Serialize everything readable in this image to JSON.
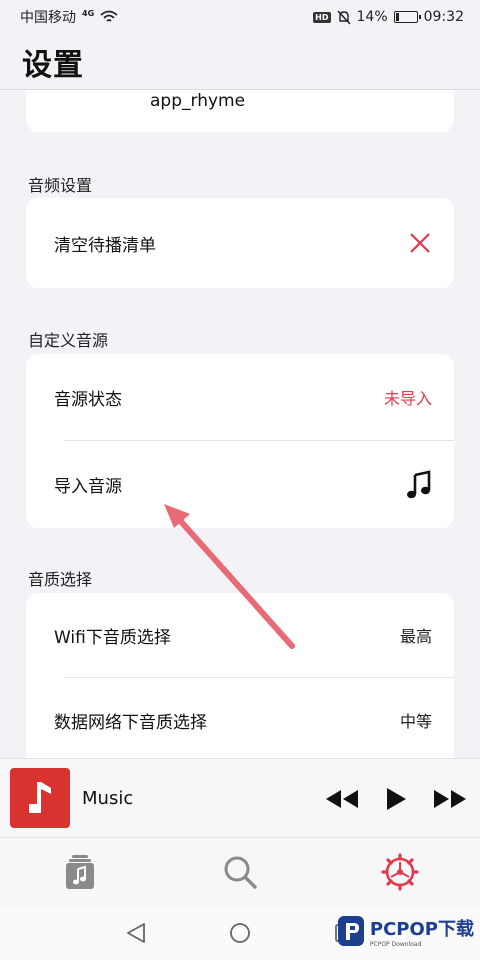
{
  "status_bar": {
    "carrier": "中国移动",
    "network": "4G",
    "hd": "HD",
    "battery_percent": "14%",
    "battery_level": 0.14,
    "time": "09:32"
  },
  "header": {
    "title": "设置"
  },
  "partial_card": {
    "value": "app_rhyme"
  },
  "sections": {
    "audio": {
      "label": "音频设置",
      "clear_queue": "清空待播清单"
    },
    "custom_source": {
      "label": "自定义音源",
      "status_label": "音源状态",
      "status_value": "未导入",
      "import_label": "导入音源"
    },
    "quality": {
      "label": "音质选择",
      "wifi_label": "Wifi下音质选择",
      "wifi_value": "最高",
      "mobile_label": "数据网络下音质选择",
      "mobile_value": "中等"
    }
  },
  "mini_player": {
    "title": "Music"
  },
  "tabs": [
    {
      "name": "library",
      "icon": "music-library-icon"
    },
    {
      "name": "search",
      "icon": "search-icon"
    },
    {
      "name": "settings",
      "icon": "settings-icon",
      "active": true
    }
  ],
  "colors": {
    "accent": "#e23b4e",
    "album": "#d9322f",
    "arrow": "#e86a75"
  },
  "watermark": {
    "text": "PCPOP下载",
    "sub": "PCPOP Download"
  }
}
